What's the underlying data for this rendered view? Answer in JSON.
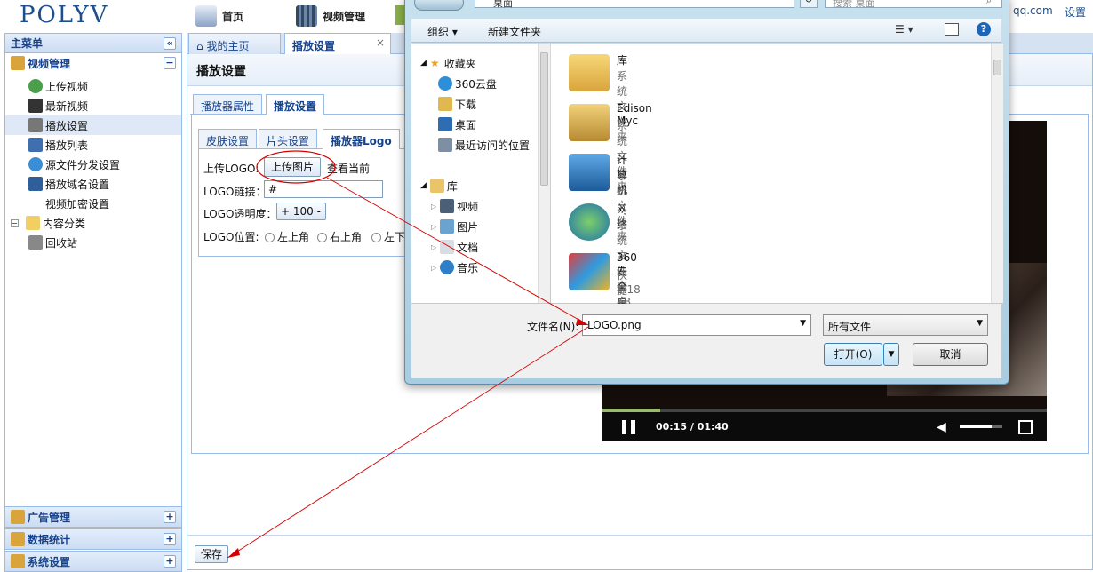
{
  "app": {
    "logo": "POLYV",
    "top_right_link": "qq.com",
    "top_right_settings": "设置"
  },
  "topnav": {
    "home": "首页",
    "video_mgmt": "视频管理"
  },
  "sidebar": {
    "title": "主菜单",
    "section": "视频管理",
    "items": [
      "上传视频",
      "最新视频",
      "播放设置",
      "播放列表",
      "源文件分发设置",
      "播放域名设置",
      "视频加密设置",
      "内容分类",
      "回收站"
    ],
    "bottom": [
      "广告管理",
      "数据统计",
      "系统设置"
    ]
  },
  "tabs": {
    "home": "我的主页",
    "play_settings": "播放设置"
  },
  "page": {
    "title": "播放设置",
    "subtabs": [
      "播放器属性",
      "播放设置"
    ],
    "innertabs": [
      "皮肤设置",
      "片头设置",
      "播放器Logo"
    ],
    "upload_logo_label": "上传LOGO:",
    "upload_button": "上传图片",
    "view_current": "查看当前",
    "logo_link_label": "LOGO链接：",
    "logo_link_value": "#",
    "opacity_label": "LOGO透明度：",
    "opacity_value": "100",
    "position_label": "LOGO位置:",
    "positions": [
      "左上角",
      "右上角",
      "左下"
    ],
    "save_button": "保存"
  },
  "video": {
    "time": "00:15 / 01:40",
    "progress": 0.13,
    "volume": 0.75
  },
  "dialog": {
    "address_text": "桌面",
    "search_placeholder": "搜索 桌面",
    "toolbar": {
      "organize": "组织",
      "new_folder": "新建文件夹"
    },
    "nav": {
      "favorites": "收藏夹",
      "fav_items": [
        "360云盘",
        "下载",
        "桌面",
        "最近访问的位置"
      ],
      "library": "库",
      "lib_items": [
        "视频",
        "图片",
        "文档",
        "音乐"
      ]
    },
    "files": [
      {
        "name": "库",
        "sub": "系统文件夹"
      },
      {
        "name": "Edison Myc",
        "sub": "系统文件夹"
      },
      {
        "name": "计算机",
        "sub": "系统文件夹"
      },
      {
        "name": "网络",
        "sub": "系统文件夹"
      },
      {
        "name": "360安全桌面",
        "sub": "快捷方式",
        "size": "1.18 KB"
      }
    ],
    "filename_label": "文件名(N):",
    "filename_value": "LOGO.png",
    "filetype": "所有文件",
    "open_button": "打开(O)",
    "cancel_button": "取消"
  },
  "colors": {
    "accent": "#15428b",
    "annotation": "#d40000",
    "panel_border": "#99bbe8"
  }
}
